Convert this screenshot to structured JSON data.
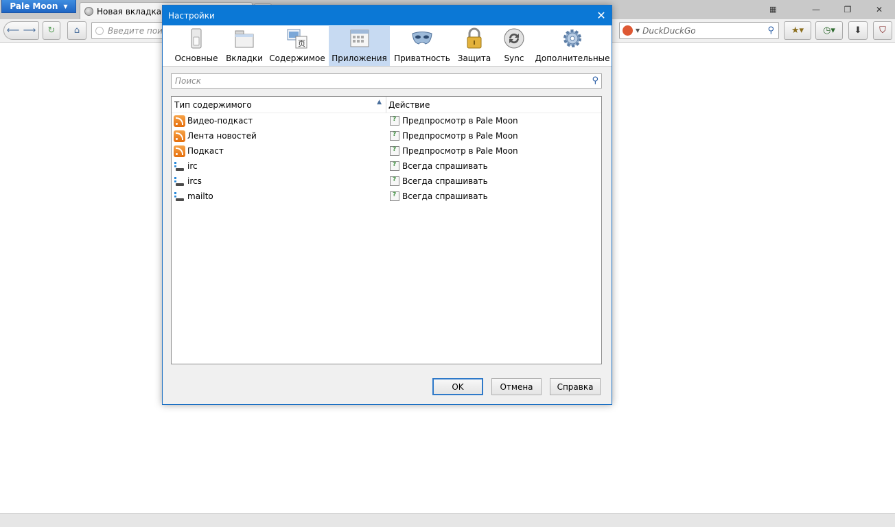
{
  "browser": {
    "app_button_label": "Pale Moon",
    "tab_title": "Новая вкладка",
    "url_placeholder": "Введите поиск",
    "search_engine": "DuckDuckGo"
  },
  "dialog": {
    "title": "Настройки",
    "panes": [
      {
        "label": "Основные",
        "icon": "switch-icon"
      },
      {
        "label": "Вкладки",
        "icon": "tabs-icon"
      },
      {
        "label": "Содержимое",
        "icon": "content-icon"
      },
      {
        "label": "Приложения",
        "icon": "applications-icon",
        "selected": true
      },
      {
        "label": "Приватность",
        "icon": "mask-icon"
      },
      {
        "label": "Защита",
        "icon": "lock-icon"
      },
      {
        "label": "Sync",
        "icon": "sync-icon"
      },
      {
        "label": "Дополнительные",
        "icon": "gear-icon"
      }
    ],
    "search_placeholder": "Поиск",
    "columns": {
      "type": "Тип содержимого",
      "action": "Действие"
    },
    "rows": [
      {
        "type": "Видео-подкаст",
        "type_icon": "rss-icon",
        "action": "Предпросмотр в Pale Moon"
      },
      {
        "type": "Лента новостей",
        "type_icon": "rss-icon",
        "action": "Предпросмотр в Pale Moon"
      },
      {
        "type": "Подкаст",
        "type_icon": "rss-icon",
        "action": "Предпросмотр в Pale Moon"
      },
      {
        "type": "irc",
        "type_icon": "protocol-icon",
        "action": "Всегда спрашивать"
      },
      {
        "type": "ircs",
        "type_icon": "protocol-icon",
        "action": "Всегда спрашивать"
      },
      {
        "type": "mailto",
        "type_icon": "protocol-icon",
        "action": "Всегда спрашивать"
      }
    ],
    "buttons": {
      "ok": "OK",
      "cancel": "Отмена",
      "help": "Справка"
    }
  },
  "colors": {
    "dialog_title_bg": "#0b78d6",
    "selected_pane_bg": "#c7daf2",
    "app_button_bg": "#2a78d4"
  }
}
